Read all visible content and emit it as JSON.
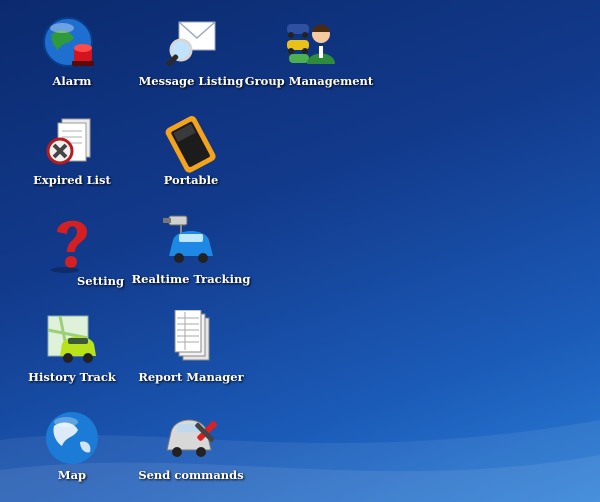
{
  "desktop": {
    "icons": [
      {
        "label": "Alarm",
        "icon": "globe-alarm-icon"
      },
      {
        "label": "Message Listing",
        "icon": "envelope-search-icon"
      },
      {
        "label": "Group Management",
        "icon": "group-users-icon"
      },
      {
        "label": "Expired List",
        "icon": "expired-document-icon"
      },
      {
        "label": "Portable",
        "icon": "portable-device-icon"
      },
      {
        "label": "Setting",
        "icon": "question-mark-icon"
      },
      {
        "label": "Realtime Tracking",
        "icon": "camera-car-icon"
      },
      {
        "label": "History Track",
        "icon": "map-car-icon"
      },
      {
        "label": "Report Manager",
        "icon": "report-sheets-icon"
      },
      {
        "label": "Map",
        "icon": "globe-icon"
      },
      {
        "label": "Send commands",
        "icon": "tools-car-icon"
      }
    ]
  },
  "colors": {
    "background_top": "#0b2a6e",
    "background_bottom": "#2a7ed6",
    "label": "#ffffff"
  }
}
